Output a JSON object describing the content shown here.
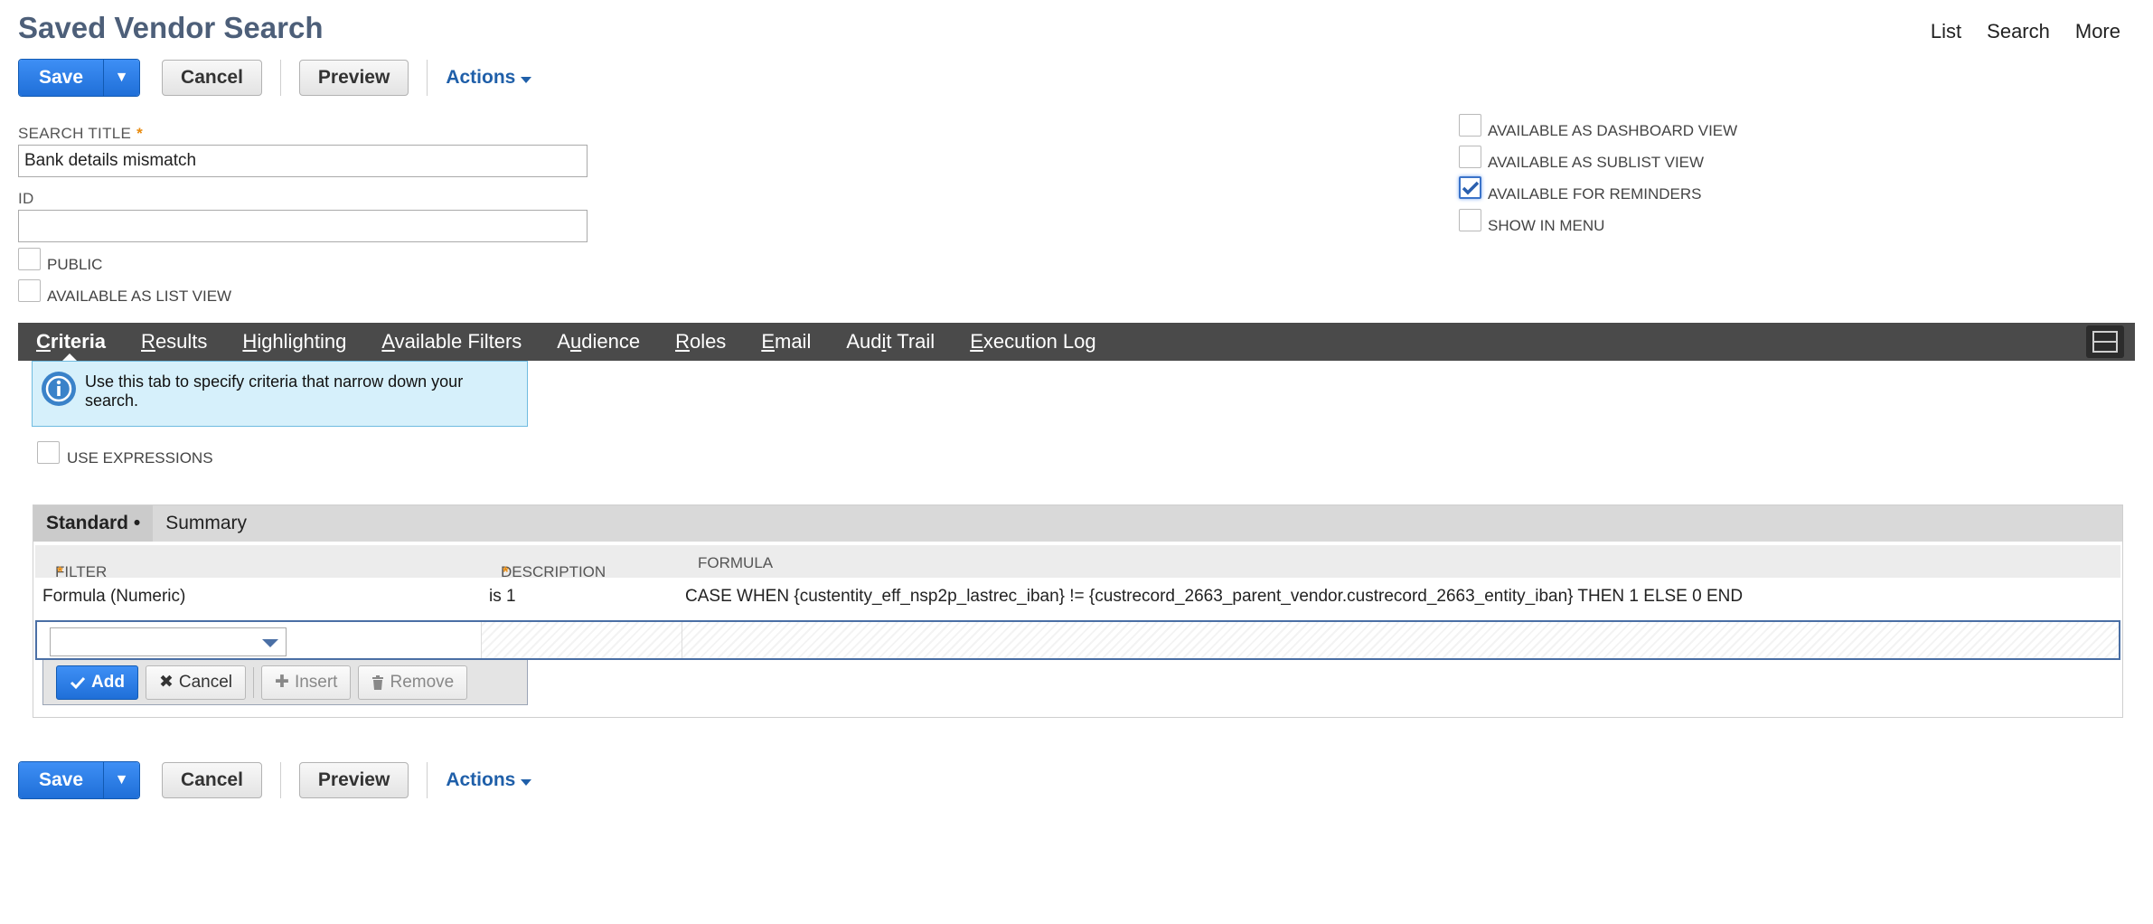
{
  "page": {
    "title": "Saved Vendor Search"
  },
  "top_links": [
    "List",
    "Search",
    "More"
  ],
  "toolbar": {
    "save_label": "Save",
    "save_menu_arrow": "▼",
    "cancel_label": "Cancel",
    "preview_label": "Preview",
    "actions_label": "Actions"
  },
  "form": {
    "search_title_label": "SEARCH TITLE",
    "required_marker": "*",
    "search_title_value": "Bank details mismatch",
    "id_label": "ID",
    "id_value": "",
    "public_label": "PUBLIC",
    "public_checked": false,
    "list_view_label": "AVAILABLE AS LIST VIEW",
    "list_view_checked": false
  },
  "right_options": [
    {
      "label": "AVAILABLE AS DASHBOARD VIEW",
      "checked": false
    },
    {
      "label": "AVAILABLE AS SUBLIST VIEW",
      "checked": false
    },
    {
      "label": "AVAILABLE FOR REMINDERS",
      "checked": true
    },
    {
      "label": "SHOW IN MENU",
      "checked": false
    }
  ],
  "tabs": [
    {
      "first": "C",
      "rest": "riteria",
      "prefix": "",
      "active": true
    },
    {
      "first": "R",
      "rest": "esults",
      "prefix": "",
      "active": false
    },
    {
      "first": "H",
      "rest": "ighlighting",
      "prefix": "",
      "active": false
    },
    {
      "first": "A",
      "rest": "vailable Filters",
      "prefix": "",
      "active": false
    },
    {
      "first": "u",
      "rest": "dience",
      "prefix": "A",
      "active": false
    },
    {
      "first": "R",
      "rest": "oles",
      "prefix": "",
      "active": false
    },
    {
      "first": "E",
      "rest": "mail",
      "prefix": "",
      "active": false
    },
    {
      "first": "i",
      "rest": "t Trail",
      "prefix": "Aud",
      "active": false
    },
    {
      "first": "E",
      "rest": "xecution Log",
      "prefix": "",
      "active": false
    }
  ],
  "info": {
    "text": "Use this tab to specify criteria that narrow down your search."
  },
  "use_expressions": {
    "label": "USE EXPRESSIONS",
    "checked": false
  },
  "subtabs": {
    "standard_label": "Standard •",
    "summary_label": "Summary"
  },
  "criteria_table": {
    "columns": [
      {
        "label": "FILTER",
        "required": true
      },
      {
        "label": "DESCRIPTION",
        "required": true
      },
      {
        "label": "FORMULA",
        "required": false
      }
    ],
    "rows": [
      {
        "filter": "Formula (Numeric)",
        "description": "is 1",
        "formula": "CASE WHEN {custentity_eff_nsp2p_lastrec_iban} != {custrecord_2663_parent_vendor.custrecord_2663_entity_iban} THEN 1 ELSE 0 END"
      }
    ]
  },
  "row_buttons": {
    "add_label": "Add",
    "cancel_label": "Cancel",
    "insert_label": "Insert",
    "remove_label": "Remove"
  }
}
